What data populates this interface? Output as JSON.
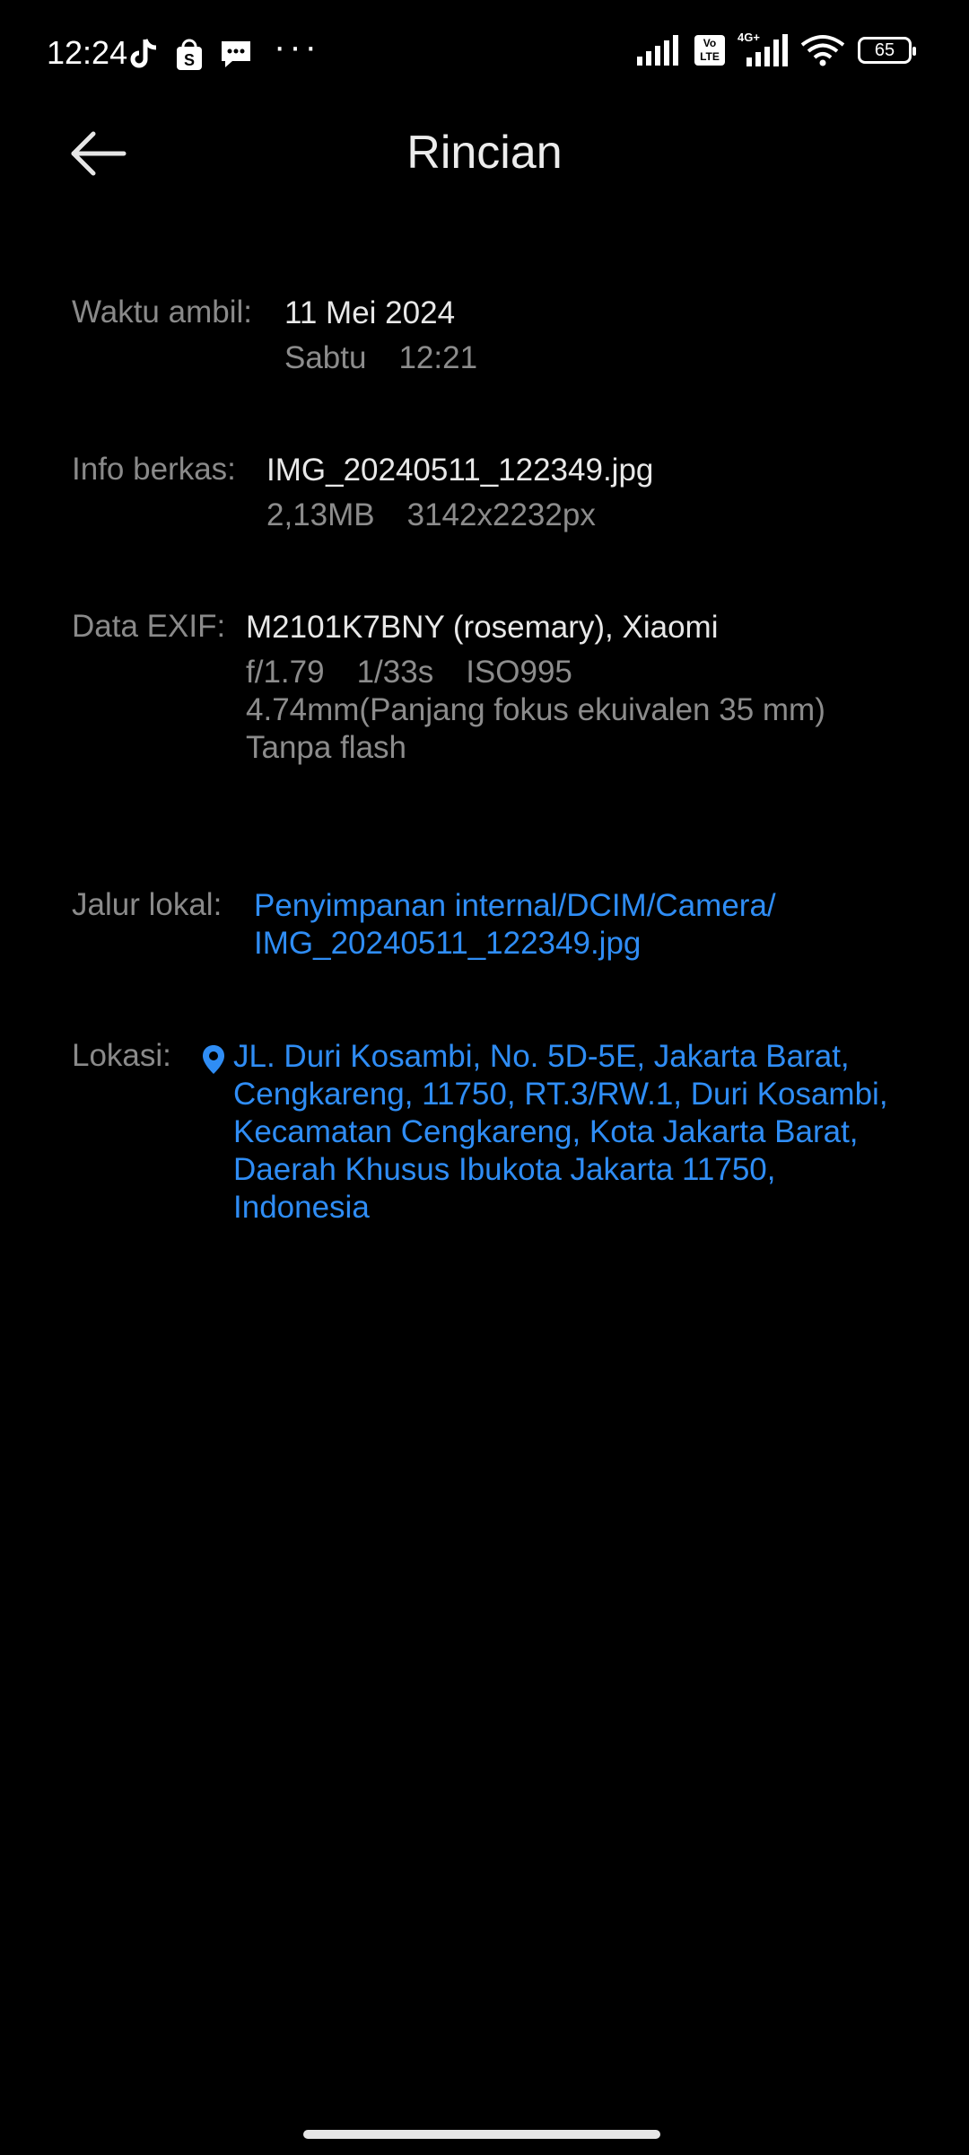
{
  "status_bar": {
    "time": "12:24",
    "network_label": "4G+",
    "volte_label": "Vo LTE",
    "battery": "65",
    "more_dots": "···"
  },
  "header": {
    "title": "Rincian",
    "back_icon": "arrow-left-icon"
  },
  "details": {
    "taken": {
      "label": "Waktu ambil:",
      "date": "11 Mei 2024",
      "day": "Sabtu",
      "time": "12:21"
    },
    "file": {
      "label": "Info berkas:",
      "name": "IMG_20240511_122349.jpg",
      "size": "2,13MB",
      "resolution": "3142x2232px"
    },
    "exif": {
      "label": "Data EXIF:",
      "device": "M2101K7BNY (rosemary), Xiaomi",
      "aperture": "f/1.79",
      "shutter": "1/33s",
      "iso": "ISO995",
      "focal": "4.74mm(Panjang fokus ekuivalen 35 mm)",
      "flash": "Tanpa flash"
    },
    "path": {
      "label": "Jalur lokal:",
      "line1": "Penyimpanan internal/DCIM/Camera/",
      "line2": "IMG_20240511_122349.jpg"
    },
    "location": {
      "label": "Lokasi:",
      "lines": [
        "JL. Duri Kosambi, No. 5D-5E, Jakarta Barat,",
        "Cengkareng, 11750, RT.3/RW.1, Duri Kosambi,",
        "Kecamatan Cengkareng, Kota Jakarta Barat,",
        "Daerah Khusus Ibukota Jakarta 11750,",
        "Indonesia"
      ]
    }
  },
  "colors": {
    "background": "#000000",
    "link": "#2f8df5",
    "label": "#8a8a8a"
  }
}
